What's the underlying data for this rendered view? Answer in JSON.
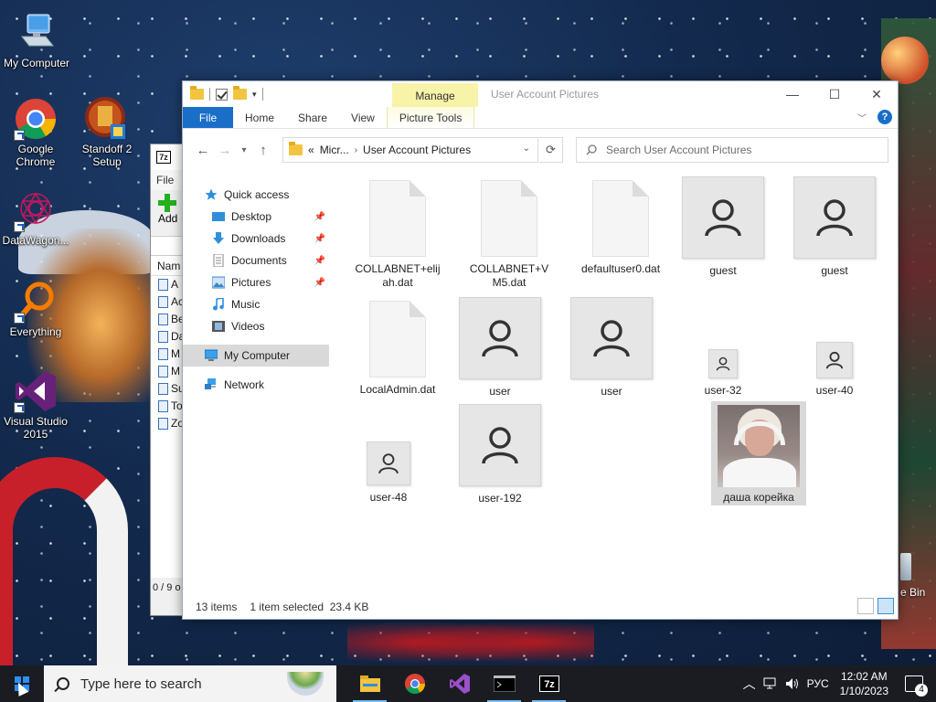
{
  "desktop": {
    "icons": [
      {
        "label": "My Computer"
      },
      {
        "label": "Google Chrome"
      },
      {
        "label": "Standoff 2 Setup"
      },
      {
        "label": "DataWagon..."
      },
      {
        "label": "Everything"
      },
      {
        "label": "Visual Studio 2015"
      }
    ],
    "recycle_bin_label": "e Bin"
  },
  "zip_window": {
    "logo": "7z",
    "menu_label": "File",
    "add_label": "Add",
    "column_header": "Nam",
    "rows": [
      "A",
      "Ac",
      "Be",
      "Da",
      "M",
      "M",
      "Su",
      "To",
      "Zo"
    ],
    "status": "0 / 9 o"
  },
  "explorer": {
    "contextual_tab_group": "Manage",
    "window_title": "User Account Pictures",
    "ribbon_tabs": [
      "File",
      "Home",
      "Share",
      "View",
      "Picture Tools"
    ],
    "address": {
      "prefix": "«",
      "crumb_1": "Micr...",
      "crumb_2": "User Account Pictures"
    },
    "search_placeholder": "Search User Account Pictures",
    "nav": {
      "quick_access": "Quick access",
      "desktop": "Desktop",
      "downloads": "Downloads",
      "documents": "Documents",
      "pictures": "Pictures",
      "music": "Music",
      "videos": "Videos",
      "my_computer": "My Computer",
      "network": "Network"
    },
    "items": [
      {
        "name": "COLLABNET+elijah.dat",
        "kind": "file"
      },
      {
        "name": "COLLABNET+VM5.dat",
        "kind": "file"
      },
      {
        "name": "defaultuser0.dat",
        "kind": "file"
      },
      {
        "name": "guest",
        "kind": "user"
      },
      {
        "name": "guest",
        "kind": "user"
      },
      {
        "name": "LocalAdmin.dat",
        "kind": "file"
      },
      {
        "name": "user",
        "kind": "user"
      },
      {
        "name": "user",
        "kind": "user"
      },
      {
        "name": "user-32",
        "kind": "user"
      },
      {
        "name": "user-40",
        "kind": "user"
      },
      {
        "name": "user-48",
        "kind": "user"
      },
      {
        "name": "user-192",
        "kind": "user"
      },
      {
        "name": "даша корейка",
        "kind": "photo",
        "selected": true
      }
    ],
    "status": {
      "count": "13 items",
      "selection": "1 item selected  23.4 KB"
    }
  },
  "taskbar": {
    "search_placeholder": "Type here to search",
    "language": "РУС",
    "time": "12:02 AM",
    "date": "1/10/2023",
    "notification_count": "4"
  },
  "colors": {
    "accent": "#1a6ec7",
    "manage_tab": "#f7f3a8",
    "taskbar": "#1b1c22"
  }
}
